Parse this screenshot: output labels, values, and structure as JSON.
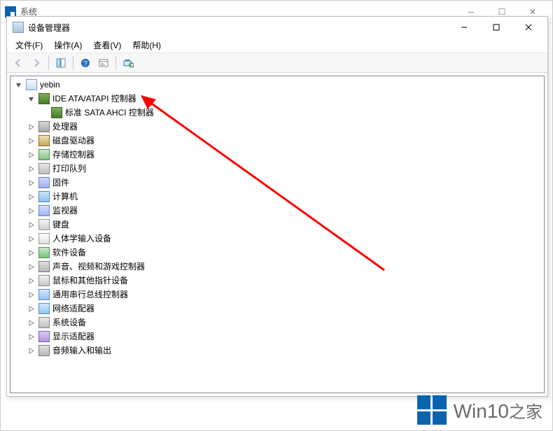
{
  "outer": {
    "title": "系统"
  },
  "window": {
    "title": "设备管理器"
  },
  "menu": {
    "file": "文件(F)",
    "action": "操作(A)",
    "view": "查看(V)",
    "help": "帮助(H)"
  },
  "tree": {
    "root": "yebin",
    "ide": "IDE ATA/ATAPI 控制器",
    "ahci": "标准 SATA AHCI 控制器",
    "processor": "处理器",
    "diskdrive": "磁盘驱动器",
    "storage": "存储控制器",
    "printqueue": "打印队列",
    "firmware": "固件",
    "computer": "计算机",
    "monitor": "监视器",
    "keyboard": "键盘",
    "hid": "人体学输入设备",
    "software": "软件设备",
    "sound": "声音、视频和游戏控制器",
    "mouse": "鼠标和其他指针设备",
    "usb": "通用串行总线控制器",
    "network": "网络适配器",
    "system": "系统设备",
    "display": "显示适配器",
    "audio": "音频输入和输出"
  },
  "watermark": {
    "brand": "Win10",
    "suffix": "之家"
  }
}
